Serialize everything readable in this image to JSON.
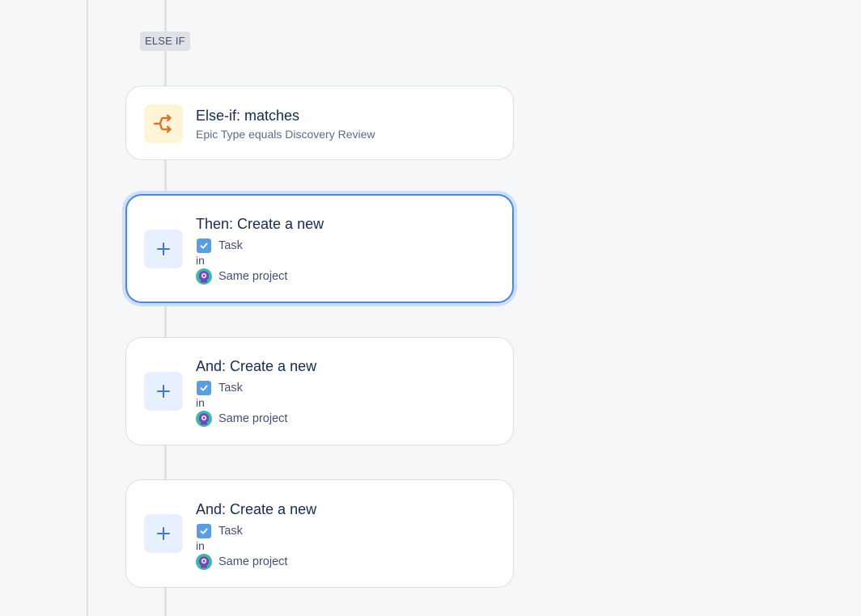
{
  "branch_label": "ELSE IF",
  "condition_card": {
    "title": "Else-if: matches",
    "subtitle": "Epic Type equals Discovery Review",
    "icon": "branch-icon",
    "accent_color": "#d9752b"
  },
  "action_cards": [
    {
      "title": "Then: Create a new",
      "issue_type": "Task",
      "in_label": "in",
      "project": "Same project",
      "selected": true
    },
    {
      "title": "And: Create a new",
      "issue_type": "Task",
      "in_label": "in",
      "project": "Same project",
      "selected": false
    },
    {
      "title": "And: Create a new",
      "issue_type": "Task",
      "in_label": "in",
      "project": "Same project",
      "selected": false
    }
  ],
  "icons": {
    "action": "plus-icon",
    "issue_type": "task-checkbox-icon",
    "project": "project-avatar-icon"
  },
  "colors": {
    "selected_border": "#4c86e0",
    "plus": "#3f78d8",
    "task": "#5b9ee0"
  }
}
